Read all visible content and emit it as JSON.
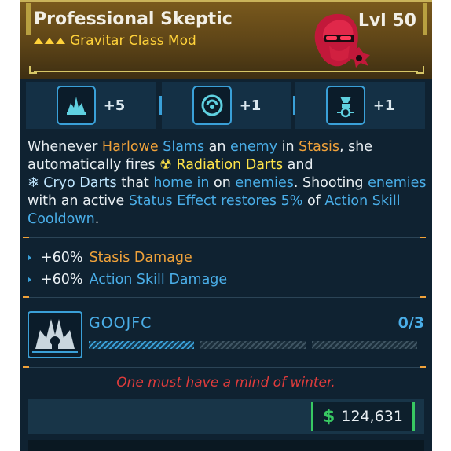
{
  "item": {
    "name": "Professional Skeptic",
    "type": "Gravitar Class Mod",
    "level": "Lvl 50",
    "rarity_color": "#ffd23a"
  },
  "stats": [
    {
      "icon": "flame-splash-icon",
      "value": "+5"
    },
    {
      "icon": "orb-swirl-icon",
      "value": "+1"
    },
    {
      "icon": "turret-icon",
      "value": "+1"
    }
  ],
  "description": {
    "p1": "Whenever ",
    "harlowe": "Harlowe",
    "slams": "Slams",
    "an": " an ",
    "enemy": "enemy",
    "in": " in ",
    "stasis": "Stasis",
    "she": ", she automatically fires ",
    "rad_icon": "☢",
    "radiation_darts": "Radiation Darts",
    "and": " and",
    "cryo_icon": "❄",
    "cryo_darts": "Cryo Darts",
    "that": " that ",
    "home_in": "home in",
    "on": " on ",
    "enemies1": "enemies",
    "shooting": ". Shooting ",
    "enemies2": "enemies",
    "with": " with an active ",
    "status_effect": "Status Effect restores 5%",
    "of": " of ",
    "cooldown": "Action Skill Cooldown",
    "end": "."
  },
  "bonuses": [
    {
      "value": "+60%",
      "label": "Stasis Damage",
      "color": "#f0a23a"
    },
    {
      "value": "+60%",
      "label": "Action Skill Damage",
      "color": "#4aaee8"
    }
  ],
  "skill": {
    "name": "GOOJFC",
    "count": "0/3",
    "icon": "crystal-burst-icon"
  },
  "flavor": "One must have a mind of winter.",
  "price": {
    "currency": "$",
    "amount": "124,631",
    "color": "#38c862"
  }
}
